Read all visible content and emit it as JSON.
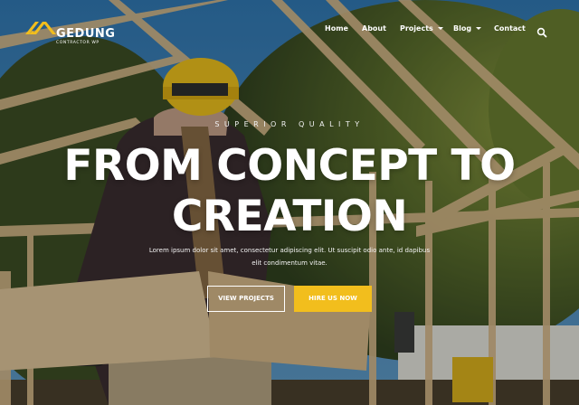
{
  "brand": {
    "name": "GEDUNG",
    "subtitle": "CONTRACTOR WP",
    "logo_color": "#f2be1d"
  },
  "nav": {
    "items": [
      {
        "label": "Home"
      },
      {
        "label": "About"
      },
      {
        "label": "Projects"
      },
      {
        "label": "Blog"
      },
      {
        "label": "Contact"
      }
    ],
    "search_icon": "search-icon",
    "dropdown_icon": "chevron-down-icon"
  },
  "hero": {
    "tagline": "SUPERIOR QUALITY",
    "headline": "FROM CONCEPT TO CREATION",
    "description": "Lorem ipsum dolor sit amet, consectetur adipiscing elit. Ut suscipit odio ante, id dapibus elit condimentum vitae.",
    "primary_button": "VIEW PROJECTS",
    "secondary_button": "HIRE US NOW",
    "accent_color": "#f2be1d"
  }
}
